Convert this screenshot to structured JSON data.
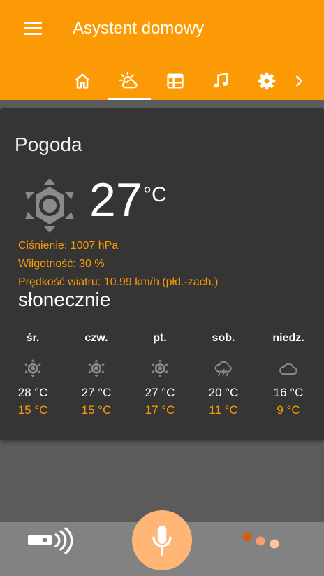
{
  "app": {
    "title": "Asystent domowy",
    "accent_color": "#fb9a05"
  },
  "appbar": {
    "menu_icon": "hamburger-menu-icon",
    "tabs": [
      {
        "icon": "home-icon",
        "selected": false
      },
      {
        "icon": "weather-sun-cloud-icon",
        "selected": true
      },
      {
        "icon": "calendar-icon",
        "selected": false
      },
      {
        "icon": "music-icon",
        "selected": false
      },
      {
        "icon": "gear-icon",
        "selected": false
      }
    ],
    "more_icon": "chevron-right-icon"
  },
  "weather": {
    "title": "Pogoda",
    "current": {
      "temperature": "27",
      "unit": "°C",
      "icon": "sun-icon",
      "pressure": "Ciśnienie: 1007 hPa",
      "humidity": "Wilgotność: 30 %",
      "wind": "Prędkość wiatru: 10.99 km/h (płd.-zach.)",
      "condition": "słonecznie"
    },
    "forecast": [
      {
        "day": "śr.",
        "icon": "sun-icon",
        "high": "28 °C",
        "low": "15 °C"
      },
      {
        "day": "czw.",
        "icon": "sun-icon",
        "high": "27 °C",
        "low": "15 °C"
      },
      {
        "day": "pt.",
        "icon": "sun-icon",
        "high": "27 °C",
        "low": "17 °C"
      },
      {
        "day": "sob.",
        "icon": "thunderstorm-cloud-icon",
        "high": "20 °C",
        "low": "11 °C"
      },
      {
        "day": "niedz.",
        "icon": "cloud-icon",
        "high": "16 °C",
        "low": "9 °C"
      }
    ]
  },
  "bottom_bar": {
    "left_icon": "remote-control-icon",
    "center_icon": "microphone-icon",
    "right_icon": "three-dots-icon"
  }
}
